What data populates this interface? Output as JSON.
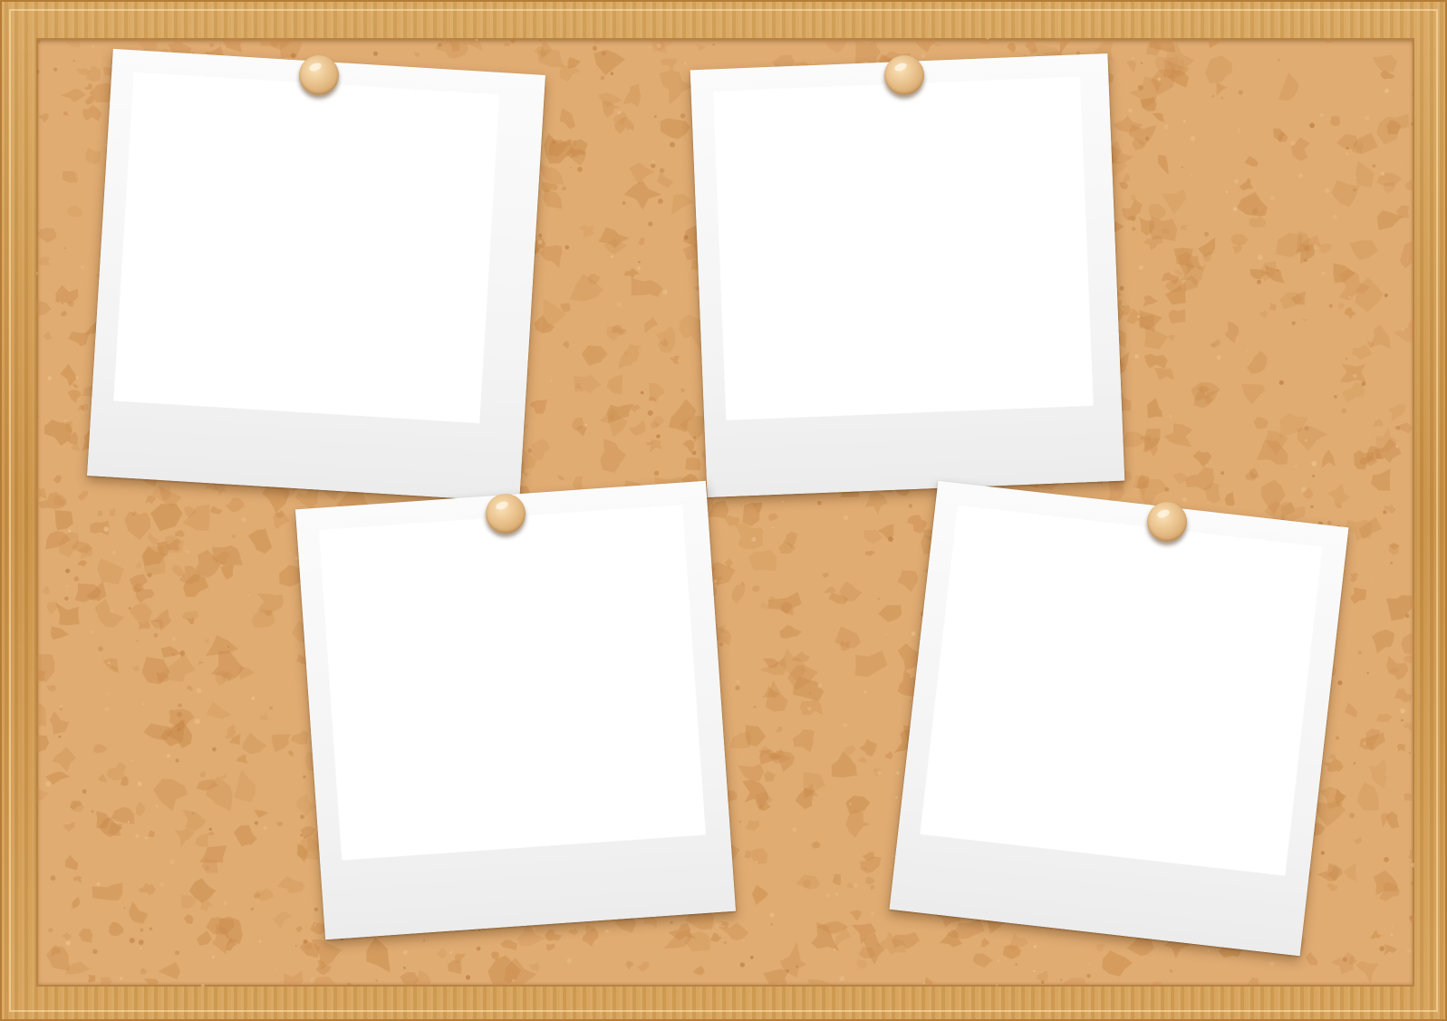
{
  "board": {
    "frame_color": "#d09a4e",
    "cork_color": "#e0ac72",
    "cork_spot_color": "#c8894a"
  },
  "photos": [
    {
      "name": "photo-top-left",
      "paper_color": "#f3f3f3",
      "image_area_color": "#ffffff"
    },
    {
      "name": "photo-top-right",
      "paper_color": "#f3f3f3",
      "image_area_color": "#ffffff"
    },
    {
      "name": "photo-bottom-left",
      "paper_color": "#f3f3f3",
      "image_area_color": "#ffffff"
    },
    {
      "name": "photo-bottom-right",
      "paper_color": "#f3f3f3",
      "image_area_color": "#ffffff"
    }
  ],
  "pins": [
    {
      "name": "pin-1",
      "color": "#e8c08a"
    },
    {
      "name": "pin-2",
      "color": "#e8c08a"
    },
    {
      "name": "pin-3",
      "color": "#e8c08a"
    },
    {
      "name": "pin-4",
      "color": "#e8c08a"
    }
  ]
}
